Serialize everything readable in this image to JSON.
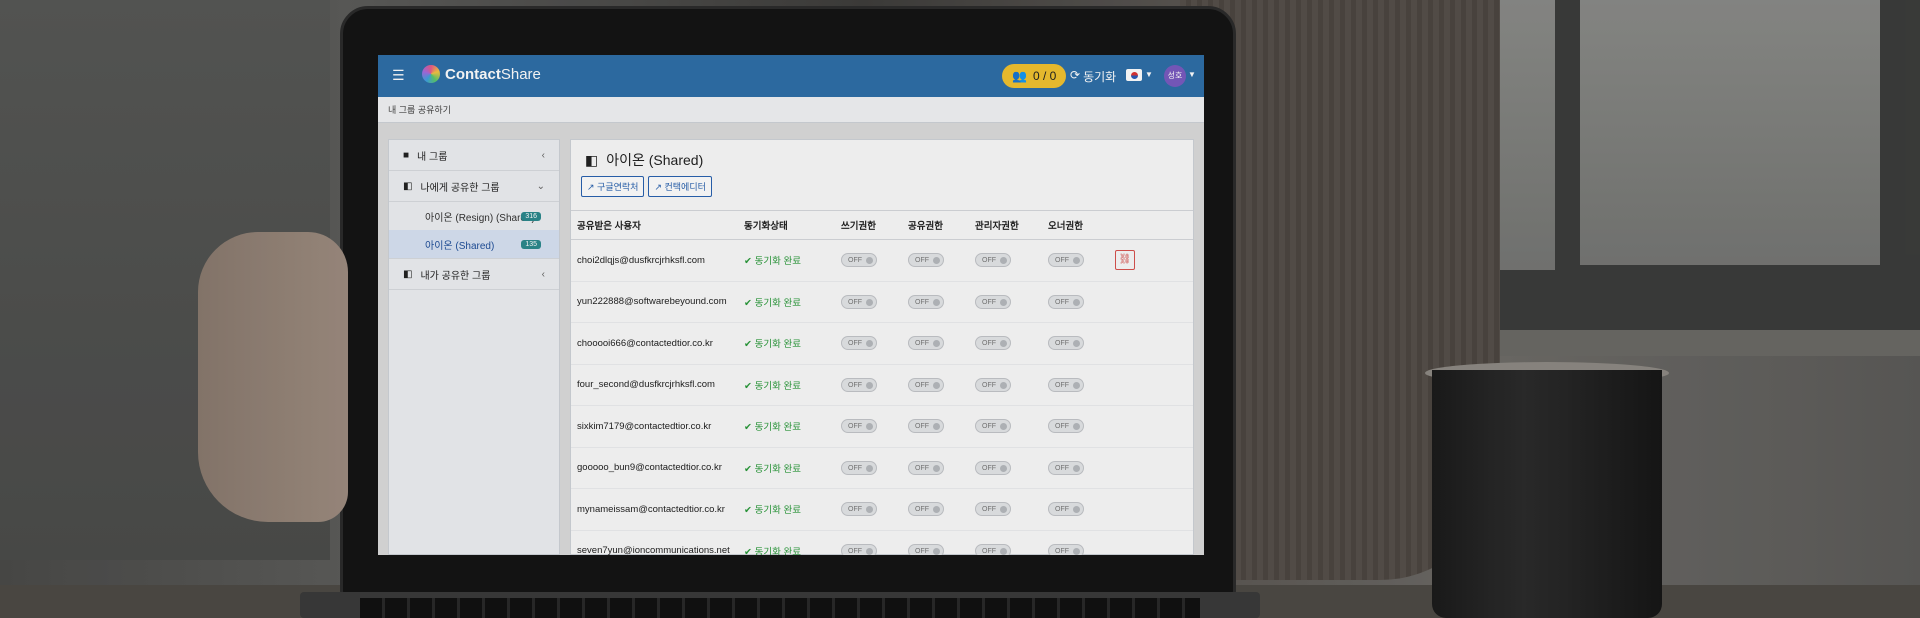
{
  "app": {
    "brand_prefix": "Contact",
    "brand_suffix": "Share"
  },
  "topbar": {
    "user_count": "0 / 0",
    "sync_label": "동기화",
    "avatar_label": "성호"
  },
  "breadcrumb": "내 그룹 공유하기",
  "sidebar": {
    "sections": [
      {
        "label": "내 그룹",
        "chevron": "‹"
      },
      {
        "label": "나에게 공유한 그룹",
        "chevron": "⌄"
      },
      {
        "label": "내가 공유한 그룹",
        "chevron": "‹"
      }
    ],
    "items": [
      {
        "label": "아이온 (Resign) (Shared)",
        "count": "316"
      },
      {
        "label": "아이온 (Shared)",
        "count": "135"
      }
    ]
  },
  "main": {
    "title": "아이온 (Shared)",
    "buttons": [
      "구글연락처",
      "컨택에디터"
    ],
    "columns": [
      "공유받은 사용자",
      "동기화상태",
      "쓰기권한",
      "공유권한",
      "관리자권한",
      "오너권한"
    ],
    "toggle_label": "OFF",
    "rows": [
      {
        "email": "choi2dlqjs@dusfkrcjrhksfl.com",
        "status": "동기화 완료"
      },
      {
        "email": "yun222888@softwarebeyound.com",
        "status": "동기화 완료"
      },
      {
        "email": "chooooi666@contactedtior.co.kr",
        "status": "동기화 완료"
      },
      {
        "email": "four_second@dusfkrcjrhksfl.com",
        "status": "동기화 완료"
      },
      {
        "email": "sixkim7179@contactedtior.co.kr",
        "status": "동기화 완료"
      },
      {
        "email": "gooooo_bun9@contactedtior.co.kr",
        "status": "동기화 완료"
      },
      {
        "email": "mynameissam@contactedtior.co.kr",
        "status": "동기화 완료"
      },
      {
        "email": "seven7yun@ioncommunications.net",
        "status": "동기화 완료"
      }
    ]
  },
  "colors": {
    "topbar": "#2f6fa8",
    "badge": "#f2c230",
    "success": "#2a9a3a",
    "danger": "#d9534f"
  },
  "icons": [
    "menu-icon",
    "users-icon",
    "sync-icon",
    "flag-korea-icon",
    "folder-icon",
    "share-icon",
    "external-link-icon",
    "check-icon",
    "unlink-icon"
  ]
}
